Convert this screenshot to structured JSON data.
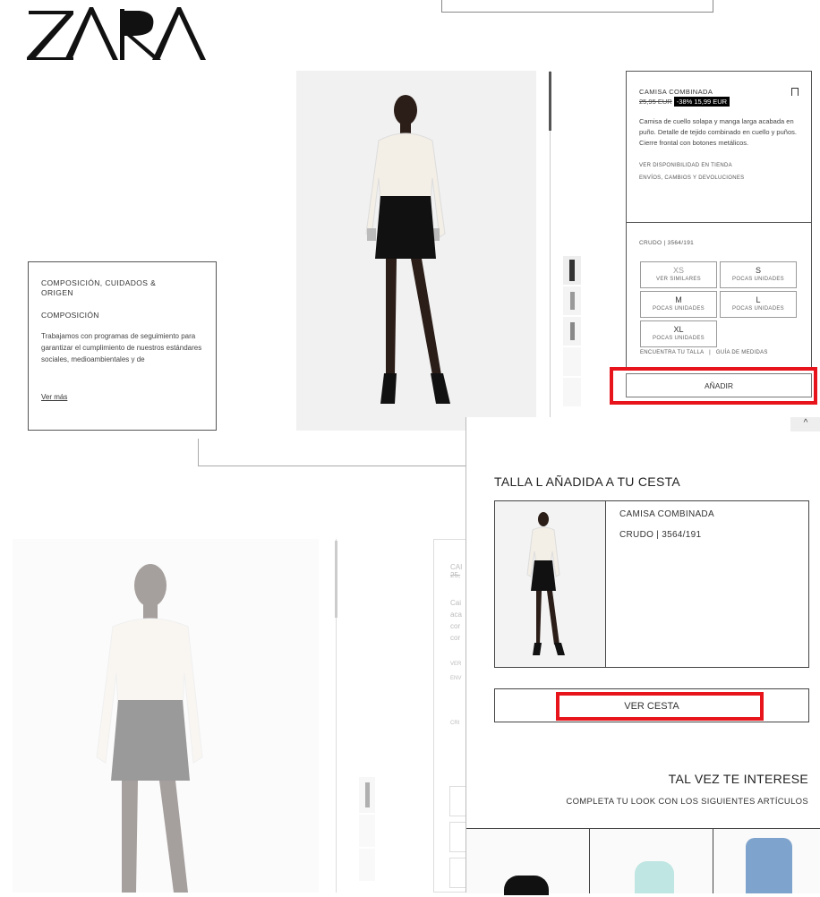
{
  "brand": {
    "logo_text": "ZARA"
  },
  "composition": {
    "title": "COMPOSICIÓN, CUIDADOS & ORIGEN",
    "subtitle": "COMPOSICIÓN",
    "body": "Trabajamos con programas de seguimiento para garantizar el cumplimiento de nuestros estándares sociales, medioambientales y de",
    "link": "Ver más"
  },
  "product": {
    "name": "CAMISA COMBINADA",
    "old_price": "25,95 EUR",
    "discount": "-38%",
    "price": "15,99 EUR",
    "description": "Camisa de cuello solapa y manga larga acabada en puño. Detalle de tejido combinado en cuello y puños. Cierre frontal con botones metálicos.",
    "link_availability": "VER DISPONIBILIDAD EN TIENDA",
    "link_shipping": "ENVÍOS, CAMBIOS Y DEVOLUCIONES",
    "color_ref": "CRUDO | 3564/191",
    "sizes": [
      {
        "label": "XS",
        "note": "VER SIMILARES"
      },
      {
        "label": "S",
        "note": "POCAS UNIDADES"
      },
      {
        "label": "M",
        "note": "POCAS UNIDADES"
      },
      {
        "label": "L",
        "note": "POCAS UNIDADES"
      },
      {
        "label": "XL",
        "note": "POCAS UNIDADES"
      }
    ],
    "find_size": "ENCUENTRA TU TALLA",
    "separator": "|",
    "size_guide": "GUÍA DE MEDIDAS",
    "add_button": "AÑADIR"
  },
  "cart_panel": {
    "heading": "TALLA L AÑADIDA A TU CESTA",
    "item_name": "CAMISA COMBINADA",
    "item_ref": "CRUDO | 3564/191",
    "view_cart": "VER CESTA",
    "suggest_title": "TAL VEZ TE INTERESE",
    "suggest_sub": "COMPLETA TU LOOK CON LOS SIGUIENTES ARTÍCULOS",
    "close_glyph": "^"
  },
  "background_fragments": {
    "name_frag": "CAI",
    "price_frag": "25,",
    "desc_frags": [
      "Cai",
      "aca",
      "cor",
      "cor"
    ],
    "link_frags": [
      "VER",
      "ENV"
    ],
    "color_frag": "CRI"
  },
  "colors": {
    "highlight": "#e8141b",
    "price_bg": "#000000"
  }
}
